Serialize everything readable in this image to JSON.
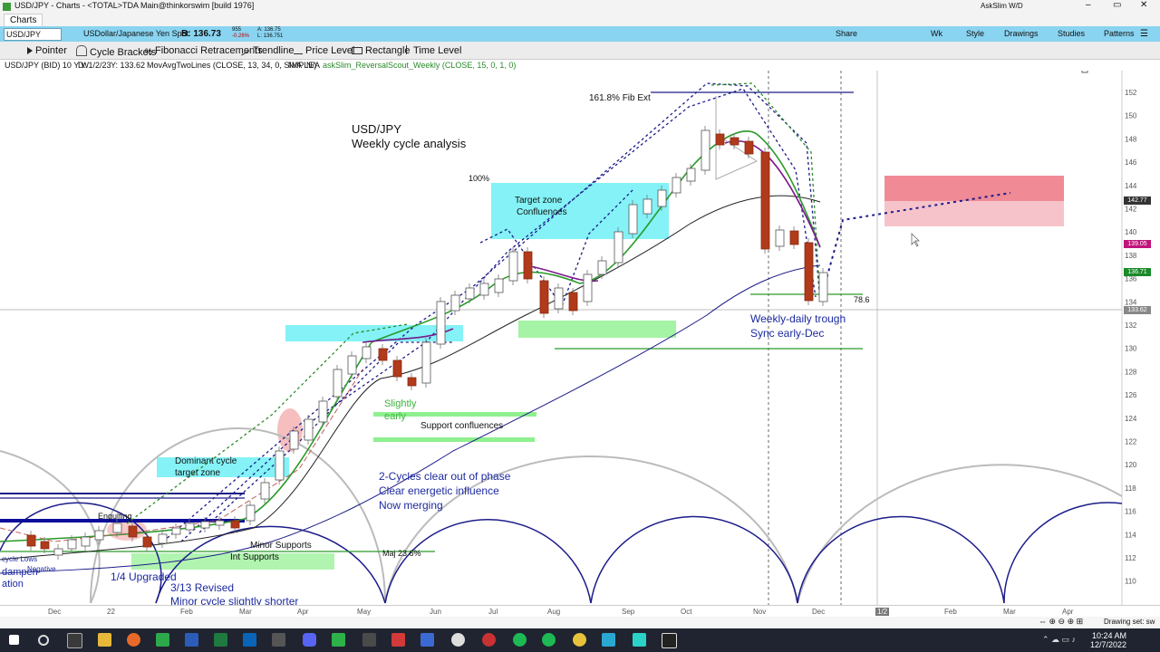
{
  "window": {
    "title": "USD/JPY - Charts - <TOTAL>TDA Main@thinkorswim [build 1976]",
    "tab": "Charts",
    "user": "AskSlim W/D",
    "controls": [
      "–",
      "▭",
      "✕"
    ]
  },
  "symbol_bar": {
    "symbol": "USD/JPY",
    "description": "USDollar/Japanese Yen Spot",
    "bid_label": "B: 136.73",
    "bid_small_1": "955",
    "bid_small_2": "-0.26%",
    "ask_small_1": "A: 136.75",
    "ask_small_2": "L: 136.751",
    "share": "Share",
    "wk": "Wk",
    "style": "Style",
    "drawings": "Drawings",
    "studies": "Studies",
    "patterns": "Patterns"
  },
  "toolbar": {
    "items": [
      "Pointer",
      "Cycle Brackets",
      "Fibonacci Retracements",
      "Trendline",
      "Price Level",
      "Rectangle",
      "Time Level"
    ]
  },
  "study_line": {
    "header": "USD/JPY (BID) 10 Y W",
    "d": "D: 1/2/23",
    "y": "Y: 133.62",
    "ma": "MovAvgTwoLines (CLOSE, 13, 34, 0, SIMPLE)",
    "na1": "N/A",
    "na2": "N/A",
    "study2": "askSlim_ReversalScout_Weekly (CLOSE, 15, 0, 1, 0)"
  },
  "price_axis": {
    "ticks": [
      "152",
      "150",
      "148",
      "146",
      "144",
      "142",
      "140",
      "138",
      "136",
      "134",
      "132",
      "130",
      "128",
      "126",
      "124",
      "122",
      "120",
      "118",
      "116",
      "114",
      "112",
      "110"
    ],
    "tags": [
      {
        "label": "142.77",
        "color": "#333333"
      },
      {
        "label": "139.05",
        "color": "#c0147a"
      },
      {
        "label": "136.71",
        "color": "#1a8a2a"
      },
      {
        "label": "133.62",
        "color": "#888888"
      }
    ]
  },
  "time_axis": {
    "ticks": [
      "Dec",
      "22",
      "Feb",
      "Mar",
      "Apr",
      "May",
      "Jun",
      "Jul",
      "Aug",
      "Sep",
      "Oct",
      "Nov",
      "Dec",
      "1/2",
      "Feb",
      "Mar",
      "Apr"
    ]
  },
  "annotations": {
    "title1": "USD/JPY",
    "title2": "Weekly cycle analysis",
    "fib_ext": "161.8% Fib Ext",
    "pct100": "100%",
    "target_zone1": "Target zone",
    "target_zone2": "Confluences",
    "weekly_daily1": "Weekly-daily trough",
    "weekly_daily2": "Sync early-Dec",
    "fib786": "78.6",
    "slightly": "Slightly",
    "early": "early",
    "support_conf": "Support confluences",
    "dom1": "Dominant cycle",
    "dom2": "target zone",
    "cycles1": "2-Cycles clear out of phase",
    "cycles2": "Clear energetic influence",
    "cycles3": "Now merging",
    "minor_supports": "Minor Supports",
    "int_supports": "Int Supports",
    "maj236": "Maj 23.6%",
    "engulfing": "Engulfing",
    "upgraded": "1/4 Upgraded",
    "revised": "3/13 Revised",
    "minor_shorter": "Minor cycle slightly shorter",
    "cycle_label": "cycle Lows",
    "negative": "Negative",
    "dampen": "dampen",
    "ation": "ation"
  },
  "status": {
    "drawing_set": "Drawing set: sw"
  },
  "taskbar": {
    "time": "10:24 AM",
    "date": "12/7/2022"
  }
}
